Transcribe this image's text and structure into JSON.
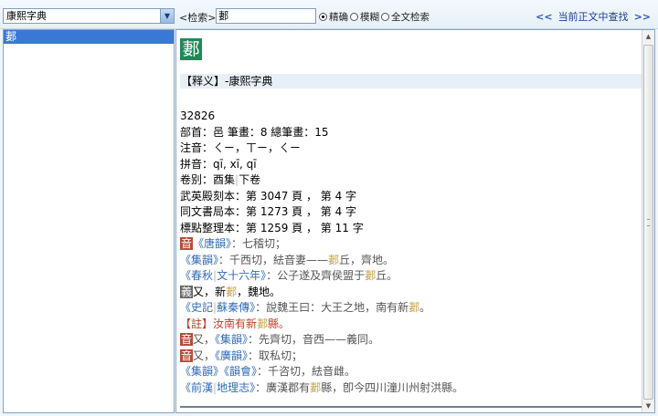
{
  "toolbar": {
    "dict_value": "康熙字典",
    "search_label": "<检索>",
    "search_value": "郪",
    "radio_exact": "精确",
    "radio_fuzzy": "模糊",
    "radio_fulltext": "全文检索",
    "prev": "<<",
    "find_in_text": "当前正文中查找",
    "next": ">>"
  },
  "list": {
    "items": [
      "郪"
    ]
  },
  "content": {
    "head_char": "郪",
    "section_title": "【释义】-康熙字典",
    "code": "32826",
    "radical": "部首：邑 筆畫：8 總筆畫：15",
    "zhuyin": "注音：ㄑㄧ，ㄒㄧ，ㄑㄧ",
    "pinyin": "拼音：qī, xī, qī",
    "volume": {
      "a": "卷别：酉集",
      "b": "下卷"
    },
    "wuying": "武英殿刻本：第 3047 頁 ， 第 4 字",
    "tongwen": "同文書局本：第 1273 頁 ， 第 4 字",
    "biaodian": "標點整理本：第 1259 頁 ， 第 11 字",
    "l1": {
      "tag": "音",
      "src": "《唐韻》",
      "rest": "：七稽切；"
    },
    "l2": {
      "src": "《集韻》",
      "a": "：千西切，紶音妻——",
      "hl": "郪",
      "b": "丘，齊地。"
    },
    "l3": {
      "src1": "《春秋",
      "src2": "文十六年》",
      "a": "：公子遂及齊侯盟于",
      "hl": "郪",
      "b": "丘。"
    },
    "l4": {
      "tag": "義",
      "a": "又，新",
      "hl": "郪",
      "b": "，魏地。"
    },
    "l5": {
      "src1": "《史記",
      "src2": "蘇秦傳》",
      "a": "：說魏王曰：大王之地，南有新",
      "hl": "郪",
      "b": "。"
    },
    "l6": {
      "a": "【註】汝南有新",
      "hl": "郪",
      "b": "縣。"
    },
    "l7": {
      "tag": "音",
      "a": "又，",
      "src": "《集韻》",
      "b": "：先齊切，音西——義同。"
    },
    "l8": {
      "tag": "音",
      "a": "又，",
      "src": "《廣韻》",
      "b": "：取私切；"
    },
    "l9": {
      "src1": "《集韻》",
      "src2": "《韻會》",
      "b": "：千咨切，紶音雌。"
    },
    "l10": {
      "src1": "《前漢",
      "src2": "地理志》",
      "a": "：廣漢郡有",
      "hl": "郪",
      "b": "縣，卽今四川潼川州射洪縣。"
    }
  }
}
